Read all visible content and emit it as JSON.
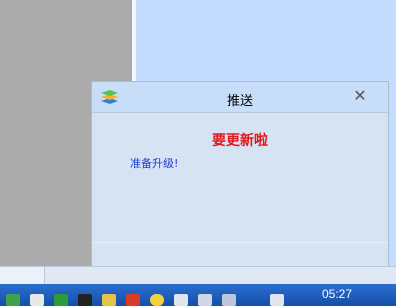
{
  "popup": {
    "title": "推送",
    "close_glyph": "✕",
    "headline": "要更新啦",
    "message": "准备升级!",
    "icon": "stacked-layers-icon"
  },
  "taskbar": {
    "clock": "05:27",
    "tray_icons": [
      "green-app-icon",
      "document-icon",
      "shield-icon",
      "penguin-icon",
      "folder-icon",
      "red-app-icon",
      "smiley-icon",
      "file-icon",
      "device-icon",
      "network-icon",
      "volume-icon"
    ]
  },
  "colors": {
    "headline": "#e3161b",
    "message": "#1f3bd6",
    "desktop": "#c3dcff",
    "taskbar": "#1f5fbf"
  }
}
